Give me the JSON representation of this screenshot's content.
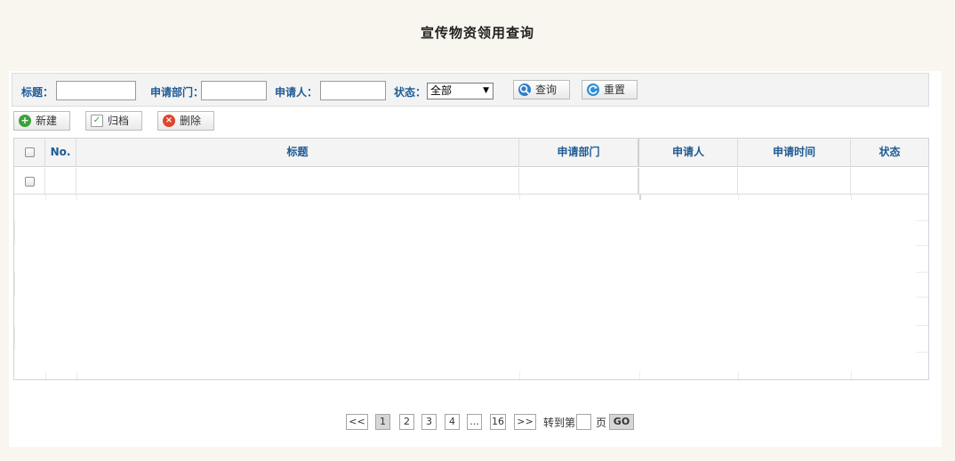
{
  "page": {
    "title": "宣传物资领用查询"
  },
  "search": {
    "title_label": "标题：",
    "dept_label": "申请部门：",
    "applicant_label": "申请人：",
    "status_label": "状态：",
    "status_value": "全部",
    "title_value": "",
    "dept_value": "",
    "applicant_value": "",
    "query_button": "查询",
    "reset_button": "重置"
  },
  "toolbar": {
    "new_button": "新建",
    "archive_button": "归档",
    "delete_button": "删除"
  },
  "table": {
    "columns": [
      "No.",
      "标题",
      "申请部门",
      "申请人",
      "申请时间",
      "状态"
    ],
    "rows": []
  },
  "pagination": {
    "first": "<<",
    "pages": [
      "1",
      "2",
      "3",
      "4",
      "...",
      "16"
    ],
    "current": "1",
    "last": ">>",
    "goto_label": "转到第",
    "page_suffix": "页",
    "go_button": "GO"
  },
  "colors": {
    "label_blue": "#1e5b94",
    "background": "#f8f6ef"
  },
  "icons": {
    "new": "plus-circle-icon",
    "archive": "archive-icon",
    "delete": "delete-icon",
    "query": "search-icon",
    "reset": "refresh-icon"
  }
}
